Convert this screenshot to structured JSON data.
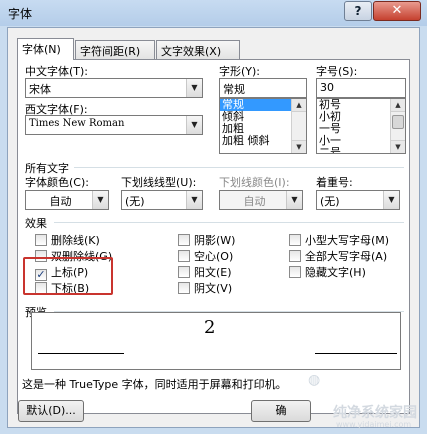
{
  "window": {
    "title": "字体",
    "help": "?",
    "close": "✕"
  },
  "tabs": [
    {
      "label": "字体(N)"
    },
    {
      "label": "字符间距(R)"
    },
    {
      "label": "文字效果(X)"
    }
  ],
  "font": {
    "chinese_label": "中文字体(T):",
    "chinese_value": "宋体",
    "western_label": "西文字体(F):",
    "western_value": "Times New Roman",
    "style_label": "字形(Y):",
    "style_value": "常规",
    "style_options": [
      "常规",
      "倾斜",
      "加粗",
      "加粗 倾斜"
    ],
    "size_label": "字号(S):",
    "size_value": "30",
    "size_options": [
      "初号",
      "小初",
      "一号",
      "小一",
      "二号"
    ]
  },
  "all_text": {
    "heading": "所有文字",
    "color_label": "字体颜色(C):",
    "color_value": "自动",
    "underline_label": "下划线线型(U):",
    "underline_value": "(无)",
    "underline_color_label": "下划线颜色(I):",
    "underline_color_value": "自动",
    "emphasis_label": "着重号:",
    "emphasis_value": "(无)"
  },
  "effects": {
    "heading": "效果",
    "items": [
      {
        "label": "删除线(K)",
        "checked": false
      },
      {
        "label": "双删除线(G)",
        "checked": false
      },
      {
        "label": "上标(P)",
        "checked": true
      },
      {
        "label": "下标(B)",
        "checked": false
      },
      {
        "label": "阴影(W)",
        "checked": false
      },
      {
        "label": "空心(O)",
        "checked": false
      },
      {
        "label": "阳文(E)",
        "checked": false
      },
      {
        "label": "阴文(V)",
        "checked": false
      },
      {
        "label": "小型大写字母(M)",
        "checked": false
      },
      {
        "label": "全部大写字母(A)",
        "checked": false
      },
      {
        "label": "隐藏文字(H)",
        "checked": false
      }
    ]
  },
  "preview": {
    "heading": "预览",
    "sample": "2",
    "note": "这是一种 TrueType 字体，同时适用于屏幕和打印机。"
  },
  "buttons": {
    "default": "默认(D)...",
    "ok": "确"
  },
  "watermark": {
    "text": "纯净系统家园",
    "url": "www.yidaimei.com"
  },
  "colors": {
    "accent": "#3399ff",
    "highlight_outline": "#c9342e"
  }
}
